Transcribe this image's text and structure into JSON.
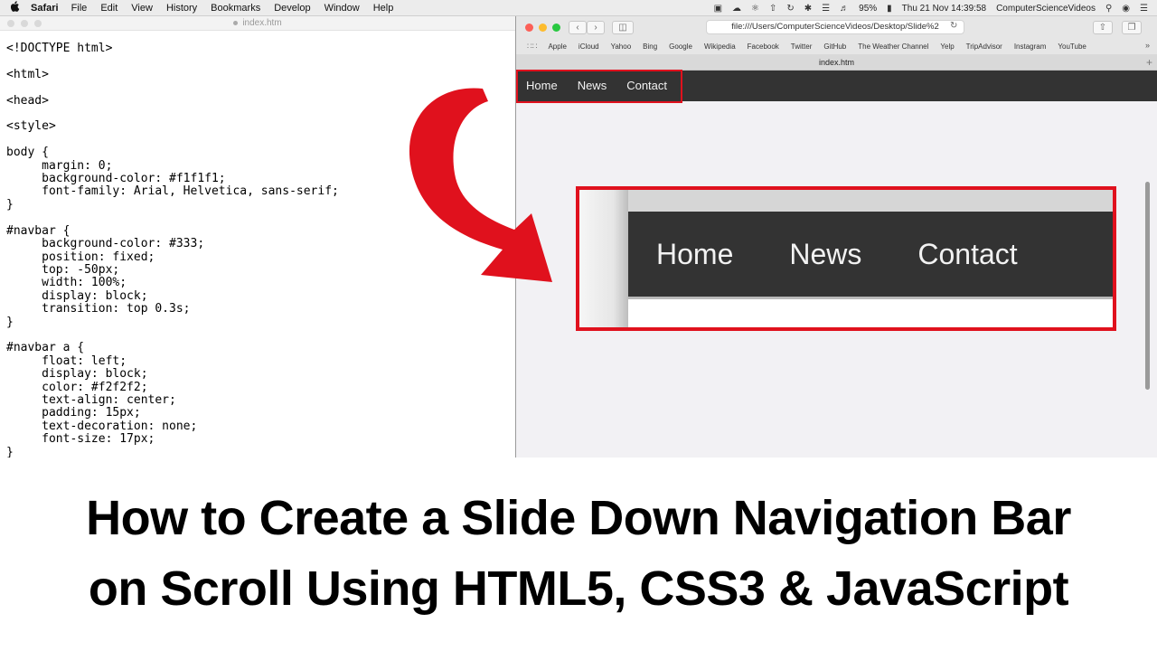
{
  "menubar": {
    "apple": "",
    "app": "Safari",
    "items": [
      "File",
      "Edit",
      "View",
      "History",
      "Bookmarks",
      "Develop",
      "Window",
      "Help"
    ],
    "battery": "95%",
    "clock": "Thu 21 Nov  14:39:58",
    "user": "ComputerScienceVideos"
  },
  "editor": {
    "tab_title": "index.htm",
    "code": "<!DOCTYPE html>\n\n<html>\n\n<head>\n\n<style>\n\nbody {\n     margin: 0;\n     background-color: #f1f1f1;\n     font-family: Arial, Helvetica, sans-serif;\n}\n\n#navbar {\n     background-color: #333;\n     position: fixed;\n     top: -50px;\n     width: 100%;\n     display: block;\n     transition: top 0.3s;\n}\n\n#navbar a {\n     float: left;\n     display: block;\n     color: #f2f2f2;\n     text-align: center;\n     padding: 15px;\n     text-decoration: none;\n     font-size: 17px;\n}"
  },
  "safari": {
    "address": "file:///Users/ComputerScienceVideos/Desktop/Slide%2",
    "bookmarks": [
      "Apple",
      "iCloud",
      "Yahoo",
      "Bing",
      "Google",
      "Wikipedia",
      "Facebook",
      "Twitter",
      "GitHub",
      "The Weather Channel",
      "Yelp",
      "TripAdvisor",
      "Instagram",
      "YouTube"
    ],
    "tab_title": "index.htm",
    "nav_links": [
      "Home",
      "News",
      "Contact"
    ]
  },
  "zoom": {
    "nav_links": [
      "Home",
      "News",
      "Contact"
    ]
  },
  "caption": {
    "line1": "How to Create a Slide Down Navigation Bar",
    "line2": "on Scroll Using HTML5, CSS3 & JavaScript"
  },
  "colors": {
    "highlight": "#e0111d",
    "navbar": "#333333",
    "nav_text": "#f2f2f2"
  },
  "icons": [
    "apple-icon",
    "back-icon",
    "forward-icon",
    "sidebar-icon",
    "reload-icon",
    "share-icon",
    "tabs-icon",
    "bookmarks-grid-icon",
    "new-tab-icon",
    "curved-arrow-icon"
  ]
}
